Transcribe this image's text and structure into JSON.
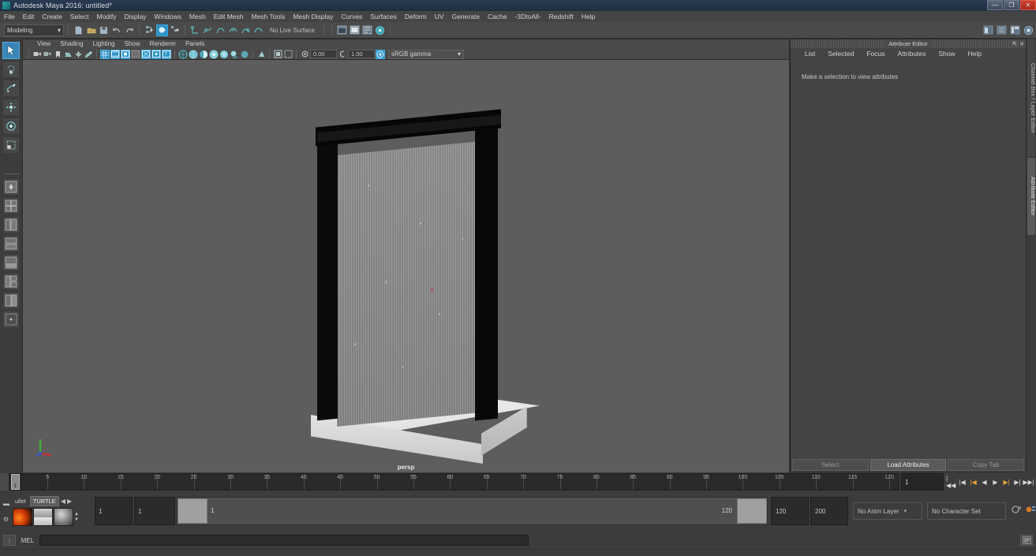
{
  "window": {
    "title": "Autodesk Maya 2016: untitled*",
    "app_icon": "maya-logo-icon",
    "controls": [
      {
        "name": "minimize",
        "glyph": "—"
      },
      {
        "name": "restore",
        "glyph": "❐"
      },
      {
        "name": "close",
        "glyph": "✕"
      }
    ]
  },
  "menubar": {
    "items": [
      "File",
      "Edit",
      "Create",
      "Select",
      "Modify",
      "Display",
      "Windows",
      "Mesh",
      "Edit Mesh",
      "Mesh Tools",
      "Mesh Display",
      "Curves",
      "Surfaces",
      "Deform",
      "UV",
      "Generate",
      "Cache",
      "-3DtoAll-",
      "Redshift",
      "Help"
    ]
  },
  "toolbar": {
    "mode_menu": {
      "value": "Modeling",
      "arrow": "▾"
    },
    "live_surface": "No Live Surface",
    "icons": [
      {
        "name": "new-scene-icon",
        "glyph": "📄"
      },
      {
        "name": "open-scene-icon",
        "glyph": "📂"
      },
      {
        "name": "save-scene-icon",
        "glyph": "💾"
      },
      {
        "name": "undo-icon",
        "glyph": "↶"
      },
      {
        "name": "redo-icon",
        "glyph": "↷"
      }
    ],
    "select_mode_icons": [
      {
        "name": "select-by-hierarchy-icon",
        "active": false
      },
      {
        "name": "select-by-object-type-icon",
        "active": true
      },
      {
        "name": "select-by-component-type-icon",
        "active": false
      }
    ],
    "snap_icons": [
      {
        "name": "snap-to-grid-icon"
      },
      {
        "name": "snap-to-curve-icon"
      },
      {
        "name": "snap-to-point-icon"
      },
      {
        "name": "snap-to-projected-center-icon"
      },
      {
        "name": "snap-to-view-plane-icon"
      },
      {
        "name": "make-live-icon"
      }
    ],
    "editor_icons": [
      {
        "name": "render-view-icon"
      },
      {
        "name": "render-sequence-icon"
      },
      {
        "name": "render-settings-icon"
      },
      {
        "name": "hypershade-icon"
      }
    ],
    "right_icons": [
      {
        "name": "show-hide-editor-icon"
      },
      {
        "name": "attribute-editor-toggle-icon"
      },
      {
        "name": "tool-settings-toggle-icon"
      },
      {
        "name": "channel-box-toggle-icon"
      }
    ]
  },
  "toolbox": {
    "tools": [
      {
        "name": "select-tool",
        "glyph": "↖",
        "selected": true
      },
      {
        "name": "lasso-select-tool",
        "glyph": "✇",
        "selected": false
      },
      {
        "name": "paint-select-tool",
        "glyph": "🖌",
        "selected": false
      },
      {
        "name": "move-tool",
        "glyph": "✥",
        "selected": false
      },
      {
        "name": "rotate-tool",
        "glyph": "◈",
        "selected": false
      },
      {
        "name": "scale-tool",
        "glyph": "⬚",
        "selected": false
      }
    ],
    "layouts": [
      {
        "name": "layout-single-pane"
      },
      {
        "name": "layout-four-pane"
      },
      {
        "name": "layout-persp-outliner"
      },
      {
        "name": "layout-persp-graph"
      },
      {
        "name": "layout-hypershade"
      },
      {
        "name": "layout-persp-hypergraph"
      },
      {
        "name": "layout-two-pane-stacked"
      },
      {
        "name": "layout-more"
      }
    ]
  },
  "viewport": {
    "menus": [
      "View",
      "Shading",
      "Lighting",
      "Show",
      "Renderer",
      "Panels"
    ],
    "label": "persp",
    "exposure_value": "0.00",
    "gamma_value": "1.00",
    "color_space": "sRGB gamma",
    "color_space_arrow": "▾",
    "icons": [
      {
        "name": "camera-icon"
      },
      {
        "name": "camera-attributes-icon"
      },
      {
        "name": "bookmark-icon"
      },
      {
        "name": "image-plane-icon"
      },
      {
        "name": "two-d-pan-zoom-icon"
      },
      {
        "name": "grease-pencil-icon"
      },
      {
        "name": "grid-toggle-icon"
      },
      {
        "name": "film-gate-icon"
      },
      {
        "name": "resolution-gate-icon"
      },
      {
        "name": "gate-mask-icon"
      },
      {
        "name": "xray-icon"
      },
      {
        "name": "xray-joints-icon"
      },
      {
        "name": "texture-toggle-icon"
      },
      {
        "name": "wireframe-shading-icon"
      },
      {
        "name": "smooth-shade-all-icon"
      },
      {
        "name": "shade-wireframe-icon"
      },
      {
        "name": "hardware-texturing-icon"
      },
      {
        "name": "use-all-lights-icon"
      },
      {
        "name": "shadows-icon"
      },
      {
        "name": "screen-space-ao-icon"
      },
      {
        "name": "motion-blur-icon"
      },
      {
        "name": "multisample-icon"
      },
      {
        "name": "exposure-icon"
      },
      {
        "name": "gamma-icon"
      },
      {
        "name": "color-management-icon"
      }
    ],
    "axis_gizmo": {
      "x_color": "#c03434",
      "y_color": "#3fb03f",
      "z_color": "#3b56c0"
    },
    "scene": {
      "description": "water-wall-partition-model",
      "background_color": "#5d5d5d",
      "frame_color": "#0a0a0a",
      "glass_color": "#8b8b8b",
      "base_color": "#e8e8e8",
      "pivot_color": "#d0325a"
    }
  },
  "attribute_editor": {
    "dock_title": "Attribute Editor",
    "dock_controls": [
      {
        "name": "undock-icon",
        "glyph": "⇱"
      },
      {
        "name": "close-icon",
        "glyph": "✕"
      }
    ],
    "menus": [
      "List",
      "Selected",
      "Focus",
      "Attributes",
      "Show",
      "Help"
    ],
    "message": "Make a selection to view attributes",
    "buttons": [
      {
        "label": "Select",
        "strong": false
      },
      {
        "label": "Load Attributes",
        "strong": true
      },
      {
        "label": "Copy Tab",
        "strong": false
      }
    ]
  },
  "side_tabs": [
    {
      "label": "Channel Box / Layer Editor",
      "active": false
    },
    {
      "label": "Attribute Editor",
      "active": true
    }
  ],
  "timeline": {
    "start": 1,
    "end": 120,
    "current_frame": "1",
    "tick_labels": [
      5,
      10,
      15,
      20,
      25,
      30,
      35,
      40,
      45,
      50,
      55,
      60,
      65,
      70,
      75,
      80,
      85,
      90,
      95,
      100,
      105,
      110,
      115,
      120
    ],
    "current_marker_label": "1",
    "playback_buttons": [
      {
        "name": "go-to-start-button",
        "glyph": "|◀◀"
      },
      {
        "name": "step-back-keyframe-button",
        "glyph": "|◀"
      },
      {
        "name": "step-back-frame-button",
        "glyph": "|◀",
        "highlight": true
      },
      {
        "name": "play-backwards-button",
        "glyph": "◀"
      },
      {
        "name": "play-forwards-button",
        "glyph": "▶"
      },
      {
        "name": "step-forward-frame-button",
        "glyph": "▶|",
        "highlight": true
      },
      {
        "name": "step-forward-keyframe-button",
        "glyph": "▶|"
      },
      {
        "name": "go-to-end-button",
        "glyph": "▶▶|"
      }
    ]
  },
  "range_slider": {
    "shelf": {
      "tabs": [
        {
          "label": "ullet",
          "selected": false
        },
        {
          "label": "TURTLE",
          "selected": true
        }
      ],
      "nav_left": "◀",
      "nav_right": "▶",
      "swatches": [
        {
          "name": "fire-material-swatch"
        },
        {
          "name": "studio-render-swatch"
        },
        {
          "name": "sphere-material-swatch"
        }
      ],
      "spin_up": "▲",
      "spin_down": "▼"
    },
    "range_start": "1",
    "anim_start": "1",
    "slider_start_label": "1",
    "slider_end_label": "120",
    "anim_end": "120",
    "range_end": "200",
    "anim_layer": "No Anim Layer",
    "anim_layer_arrow": "▾",
    "character_set": "No Character Set",
    "character_set_arrow": "▾",
    "right_icons": [
      {
        "name": "auto-keyframe-icon"
      },
      {
        "name": "animation-preferences-icon"
      }
    ]
  },
  "command_line": {
    "language_label": "MEL",
    "input_value": "",
    "script_editor_icon": "script-editor-icon"
  }
}
